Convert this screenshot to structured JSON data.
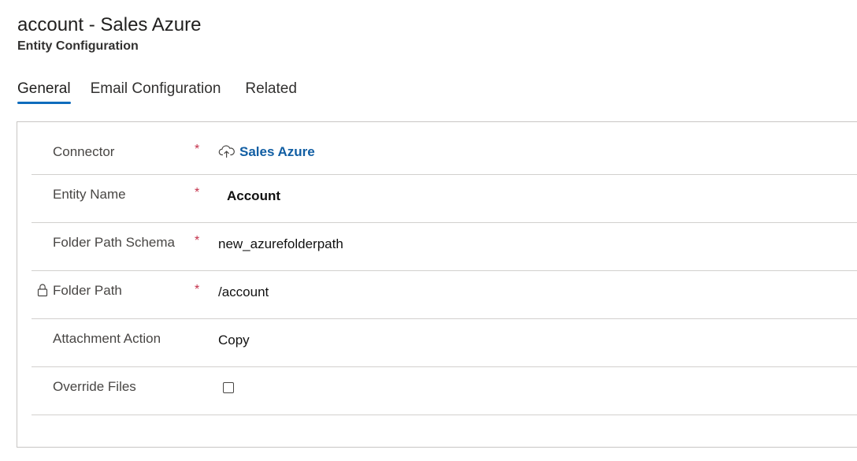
{
  "page": {
    "title": "account - Sales Azure",
    "subtitle": "Entity Configuration"
  },
  "tabs": [
    {
      "label": "General",
      "active": true
    },
    {
      "label": "Email Configuration",
      "active": false
    },
    {
      "label": "Related",
      "active": false
    }
  ],
  "form": {
    "required_marker": "*",
    "connector": {
      "label": "Connector",
      "required": true,
      "value": "Sales Azure",
      "icon": "cloud-upload-icon"
    },
    "entity_name": {
      "label": "Entity Name",
      "required": true,
      "value": "Account"
    },
    "folder_path_schema": {
      "label": "Folder Path Schema",
      "required": true,
      "value": "new_azurefolderpath"
    },
    "folder_path": {
      "label": "Folder Path",
      "required": true,
      "locked": true,
      "value": "/account",
      "icon": "lock-icon"
    },
    "attachment_action": {
      "label": "Attachment Action",
      "required": false,
      "value": "Copy"
    },
    "override_files": {
      "label": "Override Files",
      "required": false,
      "checked": false
    }
  },
  "colors": {
    "accent": "#0f6cbd",
    "link": "#115ea3",
    "required": "#c4314b",
    "border": "#d2d0ce"
  }
}
